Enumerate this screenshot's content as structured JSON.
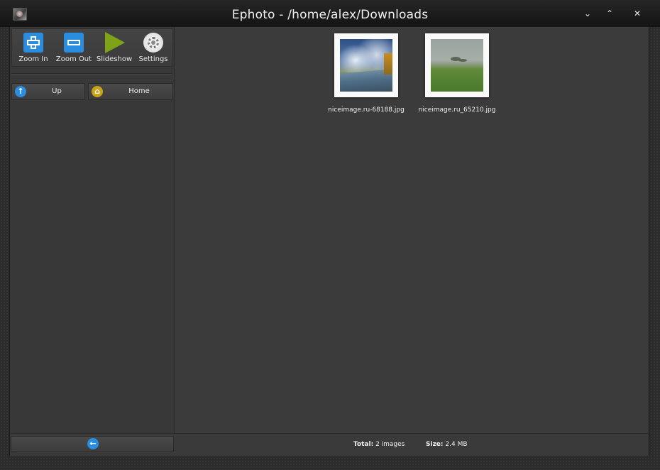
{
  "window": {
    "title": "Ephoto - /home/alex/Downloads",
    "controls": {
      "minimize": "⌄",
      "maximize": "⌃",
      "close": "✕"
    }
  },
  "toolbar": {
    "items": [
      {
        "label": "Zoom In",
        "icon": "zoom-in-icon"
      },
      {
        "label": "Zoom Out",
        "icon": "zoom-out-icon"
      },
      {
        "label": "Slideshow",
        "icon": "play-icon"
      },
      {
        "label": "Settings",
        "icon": "gear-icon"
      }
    ]
  },
  "nav": {
    "up": {
      "label": "Up",
      "icon": "arrow-up-icon",
      "glyph": "↑"
    },
    "home": {
      "label": "Home",
      "icon": "home-icon",
      "glyph": "⌂"
    }
  },
  "thumbnails": [
    {
      "filename": "niceimage.ru-68188.jpg"
    },
    {
      "filename": "niceimage.ru_65210.jpg"
    }
  ],
  "statusbar": {
    "back_glyph": "←",
    "total_label": "Total:",
    "total_value": "2 images",
    "size_label": "Size:",
    "size_value": "2.4 MB"
  },
  "colors": {
    "accent_blue": "#2a8de0",
    "slideshow_green": "#7fa318",
    "home_icon": "#c9a21a"
  }
}
